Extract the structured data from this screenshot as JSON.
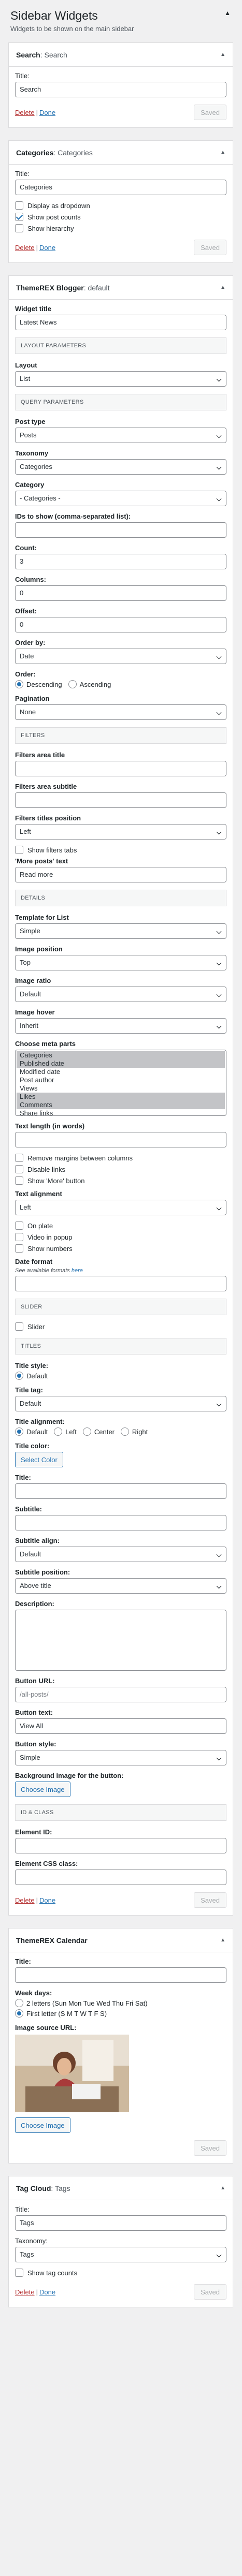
{
  "header": {
    "title": "Sidebar Widgets",
    "subtitle": "Widgets to be shown on the main sidebar"
  },
  "search_widget": {
    "title": "Search",
    "subtitle": "Search",
    "title_label": "Title:",
    "title_value": "Search",
    "delete": "Delete",
    "sep": "|",
    "done": "Done",
    "save": "Saved"
  },
  "categories_widget": {
    "title": "Categories",
    "subtitle": "Categories",
    "title_label": "Title:",
    "title_value": "Categories",
    "opts": [
      {
        "label": "Display as dropdown",
        "checked": false
      },
      {
        "label": "Show post counts",
        "checked": true
      },
      {
        "label": "Show hierarchy",
        "checked": false
      }
    ],
    "delete": "Delete",
    "sep": "|",
    "done": "Done",
    "save": "Saved"
  },
  "blogger_widget": {
    "title": "ThemeREX Blogger",
    "subtitle": "default",
    "widget_title_label": "Widget title",
    "widget_title_value": "Latest News",
    "sec_layout": "LAYOUT PARAMETERS",
    "layout_label": "Layout",
    "layout_value": "List",
    "sec_query": "QUERY PARAMETERS",
    "post_type_label": "Post type",
    "post_type_value": "Posts",
    "taxonomy_label": "Taxonomy",
    "taxonomy_value": "Categories",
    "category_label": "Category",
    "category_value": "- Categories -",
    "ids_label": "IDs to show (comma-separated list):",
    "count_label": "Count:",
    "count_value": "3",
    "columns_label": "Columns:",
    "columns_value": "0",
    "offset_label": "Offset:",
    "offset_value": "0",
    "orderby_label": "Order by:",
    "orderby_value": "Date",
    "order_label": "Order:",
    "order_desc": "Descending",
    "order_asc": "Ascending",
    "pagination_label": "Pagination",
    "pagination_value": "None",
    "sec_filters": "FILTERS",
    "filters_title_label": "Filters area title",
    "filters_subtitle_label": "Filters area subtitle",
    "filters_align_label": "Filters titles position",
    "filters_align_value": "Left",
    "show_filters_tabs": "Show filters tabs",
    "more_label": "'More posts' text",
    "more_value": "Read more",
    "sec_details": "DETAILS",
    "template_label": "Template for List",
    "template_value": "Simple",
    "image_pos_label": "Image position",
    "image_pos_value": "Top",
    "image_ratio_label": "Image ratio",
    "image_ratio_value": "Default",
    "image_hover_label": "Image hover",
    "image_hover_value": "Inherit",
    "meta_label": "Choose meta parts",
    "meta_items": [
      {
        "label": "Categories",
        "sel": true
      },
      {
        "label": "Published date",
        "sel": true
      },
      {
        "label": "Modified date",
        "sel": false
      },
      {
        "label": "Post author",
        "sel": false
      },
      {
        "label": "Views",
        "sel": false
      },
      {
        "label": "Likes",
        "sel": true
      },
      {
        "label": "Comments",
        "sel": true
      },
      {
        "label": "Share links",
        "sel": false
      }
    ],
    "text_length_label": "Text length (in words)",
    "remove_margins": "Remove margins between columns",
    "disable_links": "Disable links",
    "show_more_btn": "Show 'More' button",
    "text_align_label": "Text alignment",
    "text_align_value": "Left",
    "on_plate": "On plate",
    "video_popup": "Video in popup",
    "show_numbers": "Show numbers",
    "date_format_label": "Date format",
    "date_format_hint": "See available formats",
    "date_format_link": "here",
    "sec_slider": "SLIDER",
    "slider": "Slider",
    "sec_titles": "TITLES",
    "title_style_label": "Title style:",
    "title_style_value": "Default",
    "title_tag_label": "Title tag:",
    "title_tag_value": "Default",
    "title_align_label": "Title alignment:",
    "align_opts": [
      "Default",
      "Left",
      "Center",
      "Right"
    ],
    "title_color_label": "Title color:",
    "select_color": "Select Color",
    "title_label": "Title:",
    "subtitle_label": "Subtitle:",
    "subtitle_align_label": "Subtitle align:",
    "subtitle_align_value": "Default",
    "subtitle_pos_label": "Subtitle position:",
    "subtitle_pos_value": "Above title",
    "description_label": "Description:",
    "btn_url_label": "Button URL:",
    "btn_url_placeholder": "/all-posts/",
    "btn_text_label": "Button text:",
    "btn_text_value": "View All",
    "btn_style_label": "Button style:",
    "btn_style_value": "Simple",
    "bg_image_label": "Background image for the button:",
    "choose_image": "Choose Image",
    "sec_id": "ID & CLASS",
    "el_id_label": "Element ID:",
    "el_css_label": "Element CSS class:",
    "delete": "Delete",
    "sep": "|",
    "done": "Done",
    "save": "Saved"
  },
  "calendar_widget": {
    "title": "ThemeREX Calendar",
    "subtitle": "",
    "title_label": "Title:",
    "week_days_label": "Week days:",
    "wd_opt1": "2 letters (Sun Mon Tue Wed Thu Fri Sat)",
    "wd_opt2": "First letter (S M T W T F S)",
    "image_label": "Image source URL:",
    "choose_image": "Choose Image",
    "save": "Saved"
  },
  "tags_widget": {
    "title": "Tag Cloud",
    "subtitle": "Tags",
    "title_label": "Title:",
    "title_value": "Tags",
    "taxonomy_label": "Taxonomy:",
    "taxonomy_value": "Tags",
    "show_counts": "Show tag counts",
    "delete": "Delete",
    "sep": "|",
    "done": "Done",
    "save": "Saved"
  }
}
